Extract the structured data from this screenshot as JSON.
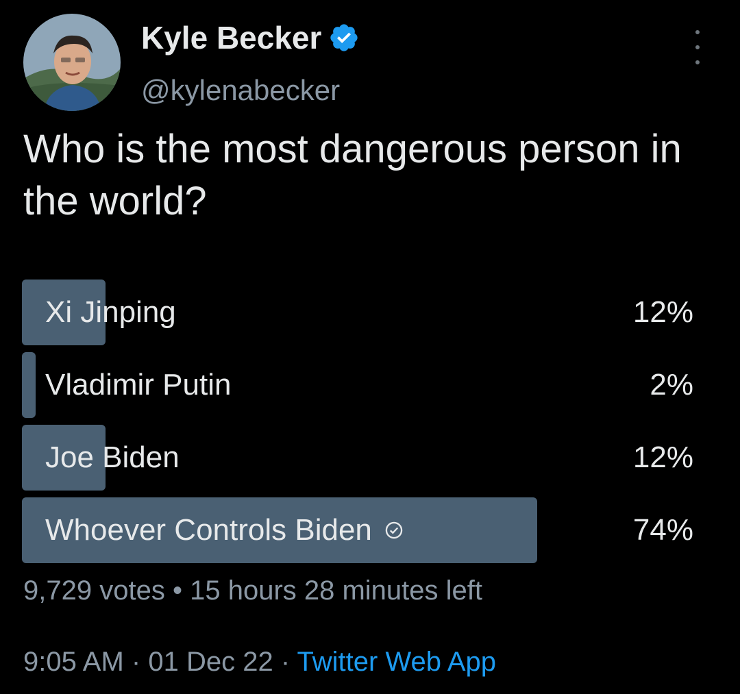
{
  "author": {
    "display_name": "Kyle Becker",
    "handle": "@kylenabecker",
    "verified": true
  },
  "tweet": {
    "text": "Who is the most dangerous person in the world?"
  },
  "poll": {
    "options": [
      {
        "label": "Xi Jinping",
        "percent_label": "12%",
        "percent": 12,
        "winner": false
      },
      {
        "label": "Vladimir Putin",
        "percent_label": "2%",
        "percent": 2,
        "winner": false
      },
      {
        "label": "Joe Biden",
        "percent_label": "12%",
        "percent": 12,
        "winner": false
      },
      {
        "label": "Whoever Controls Biden",
        "percent_label": "74%",
        "percent": 74,
        "winner": true
      }
    ],
    "votes": "9,729 votes",
    "separator": "•",
    "time_left": "15 hours 28 minutes left"
  },
  "footer": {
    "time": "9:05 AM",
    "separator": "·",
    "date": "01 Dec 22",
    "source": "Twitter Web App"
  },
  "colors": {
    "background": "#000000",
    "poll_bar": "#4a6073",
    "link": "#1d9bf0",
    "verified": "#1d9bf0",
    "muted_text": "#8b98a5"
  },
  "icons": {
    "avatar": "profile-photo",
    "verified": "verified-badge-icon",
    "more": "more-options-icon",
    "winner": "check-circle-icon"
  }
}
